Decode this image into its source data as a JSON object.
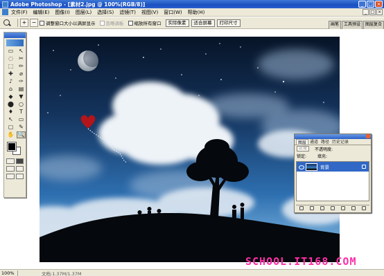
{
  "window": {
    "title": "Adobe Photoshop - [素材2.jpg @ 100%(RGB/8)]",
    "controls": [
      "_",
      "□",
      "×"
    ]
  },
  "menu": {
    "items": [
      "文件(F)",
      "编辑(E)",
      "图像(I)",
      "图层(L)",
      "选择(S)",
      "滤镜(T)",
      "视图(V)",
      "窗口(W)",
      "帮助(H)"
    ],
    "doc_controls": [
      "_",
      "□",
      "×"
    ]
  },
  "options": {
    "zoom_in": "+",
    "zoom_out": "−",
    "resize_windows": "调整窗口大小以满屏显示",
    "ignore_palettes": "忽略调板",
    "zoom_all": "缩放所有窗口",
    "actual_pixels": "实际像素",
    "fit_screen": "适合屏幕",
    "print_size": "打印尺寸",
    "palette_well": [
      "画笔",
      "工具预设",
      "图层复合"
    ]
  },
  "toolbox": {
    "tools": [
      "▭",
      "↖",
      "◌",
      "✂",
      "⬚",
      "✏",
      "✚",
      "⌀",
      "♪",
      "✑",
      "⌂",
      "▤",
      "◆",
      "▼",
      "⬤",
      "○",
      "♦",
      "T",
      "↖",
      "▭",
      "▢",
      "✎",
      "✋",
      "🔍"
    ]
  },
  "layers_palette": {
    "tabs": [
      "图层",
      "通道",
      "路径",
      "历史记录"
    ],
    "blend_mode": "正常",
    "opacity_label": "不透明度:",
    "lock_label": "锁定:",
    "fill_label": "填充:",
    "layer_name": "背景"
  },
  "watermark": "SCHOOL.IT168.COM",
  "status": {
    "zoom": "100%",
    "doc_info": "文档:1.37M/1.37M"
  }
}
